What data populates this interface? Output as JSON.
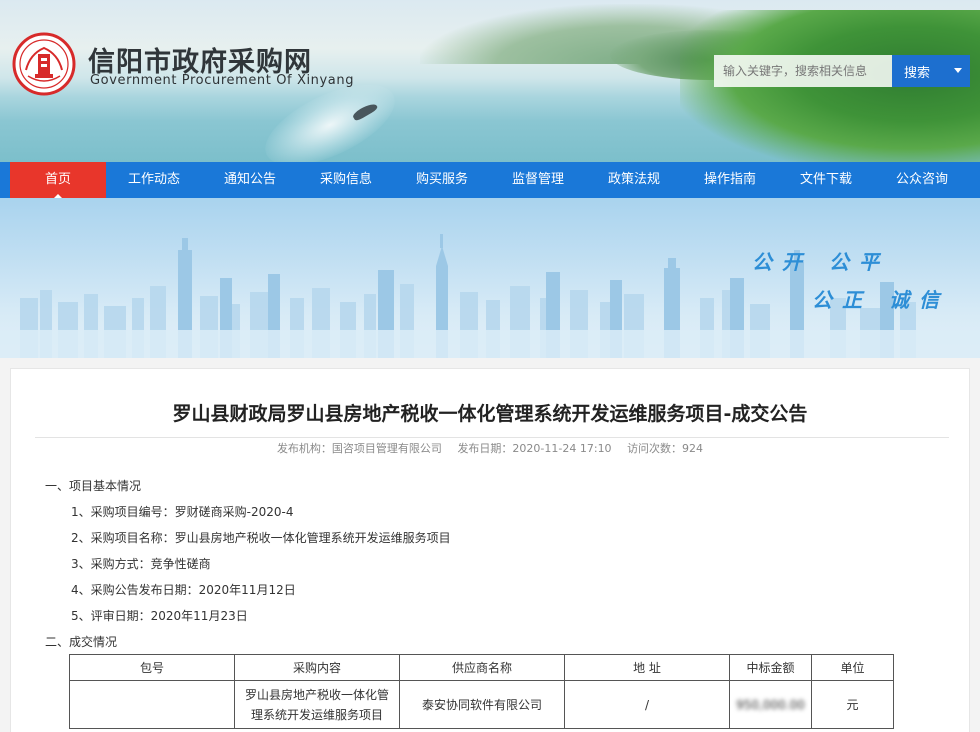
{
  "header": {
    "title": "信阳市政府采购网",
    "subtitle": "Government Procurement Of Xinyang",
    "emblem_icon": "government-procurement-emblem",
    "search": {
      "placeholder": "输入关键字，搜索相关信息",
      "button_label": "搜索"
    }
  },
  "nav": {
    "items": [
      "首页",
      "工作动态",
      "通知公告",
      "采购信息",
      "购买服务",
      "监督管理",
      "政策法规",
      "操作指南",
      "文件下载",
      "公众咨询"
    ],
    "active_index": 0,
    "colors": {
      "bar": "#1a78d8",
      "active": "#e8362b"
    }
  },
  "banner": {
    "slogan_line1": "公开 公平",
    "slogan_line2": "公正 诚信"
  },
  "article": {
    "title": "罗山县财政局罗山县房地产税收一体化管理系统开发运维服务项目-成交公告",
    "meta": {
      "publisher": "发布机构：国咨项目管理有限公司",
      "date": "发布日期：2020-11-24 17:10",
      "views": "访问次数：924"
    },
    "sections": {
      "basic_heading": "一、项目基本情况",
      "basic_items": [
        "1、采购项目编号：罗财磋商采购-2020-4",
        "2、采购项目名称：罗山县房地产税收一体化管理系统开发运维服务项目",
        "3、采购方式：竞争性磋商",
        "4、采购公告发布日期：2020年11月12日",
        "5、评审日期：2020年11月23日"
      ],
      "result_heading": "二、成交情况"
    },
    "table": {
      "headers": [
        "包号",
        "采购内容",
        "供应商名称",
        "地 址",
        "中标金额",
        "单位"
      ],
      "rows": [
        {
          "package": "",
          "content_line1": "罗山县房地产税收一体化管",
          "content_line2": "理系统开发运维服务项目",
          "supplier": "泰安协同软件有限公司",
          "address": "/",
          "amount": "950,000.00",
          "unit": "元"
        }
      ]
    }
  }
}
